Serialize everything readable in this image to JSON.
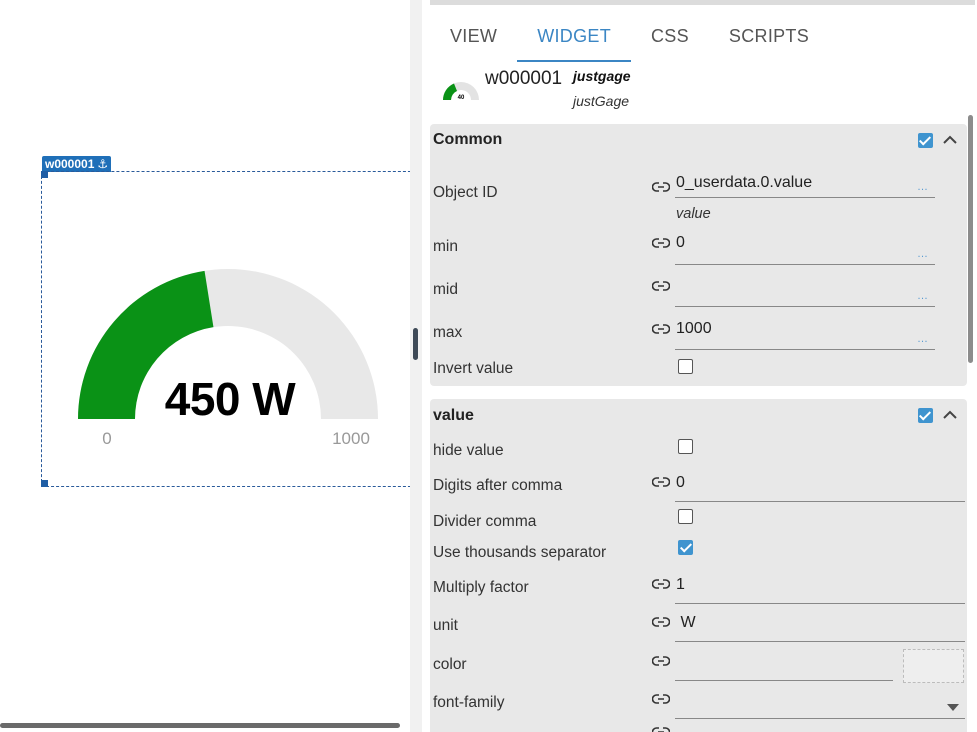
{
  "canvas": {
    "widget_tag": "w000001",
    "gauge": {
      "value_text": "450 W",
      "min_label": "0",
      "max_label": "1000",
      "value": 450,
      "min": 0,
      "max": 1000,
      "fill_color": "#0a9216",
      "track_color": "#e8e8e8"
    }
  },
  "tabs": [
    {
      "label": "VIEW"
    },
    {
      "label": "WIDGET"
    },
    {
      "label": "CSS"
    },
    {
      "label": "SCRIPTS"
    }
  ],
  "widget_info": {
    "id": "w000001",
    "set": "justgage",
    "type": "justGage",
    "icon_value": "40"
  },
  "common": {
    "title": "Common",
    "object_id_label": "Object ID",
    "object_id_value": "0_userdata.0.value",
    "object_id_sub": "value",
    "min_label": "min",
    "min_value": "0",
    "mid_label": "mid",
    "mid_value": "",
    "max_label": "max",
    "max_value": "1000",
    "invert_label": "Invert value"
  },
  "value_group": {
    "title": "value",
    "hide_value_label": "hide value",
    "digits_label": "Digits after comma",
    "digits_value": "0",
    "divider_label": "Divider comma",
    "thousands_label": "Use thousands separator",
    "multiply_label": "Multiply factor",
    "multiply_value": "1",
    "unit_label": "unit",
    "unit_value": " W",
    "color_label": "color",
    "color_value": "",
    "font_label": "font-family",
    "font_value": ""
  },
  "colors": {
    "accent": "#3b86c4",
    "selection": "#1f6fb8"
  }
}
